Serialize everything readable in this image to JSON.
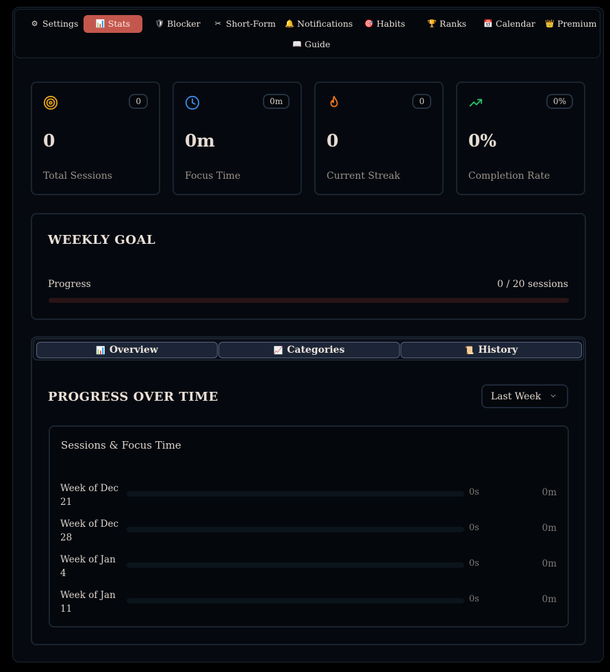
{
  "nav": {
    "items": [
      {
        "label": "Settings",
        "icon": "⚙"
      },
      {
        "label": "Stats",
        "icon": "📊"
      },
      {
        "label": "Blocker",
        "icon": "🛡"
      },
      {
        "label": "Short-Form",
        "icon": "✂"
      },
      {
        "label": "Notifications",
        "icon": "🔔"
      },
      {
        "label": "Habits",
        "icon": "🎯"
      },
      {
        "label": "Ranks",
        "icon": "🏆"
      },
      {
        "label": "Calendar",
        "icon": "📅"
      },
      {
        "label": "Premium",
        "icon": "👑"
      },
      {
        "label": "Guide",
        "icon": "📖"
      }
    ],
    "active": "Stats"
  },
  "stats": [
    {
      "badge": "0",
      "value": "0",
      "label": "Total Sessions",
      "icon": "target-icon",
      "color": "#e7a21c"
    },
    {
      "badge": "0m",
      "value": "0m",
      "label": "Focus Time",
      "icon": "clock-icon",
      "color": "#3b8be6"
    },
    {
      "badge": "0",
      "value": "0",
      "label": "Current Streak",
      "icon": "flame-icon",
      "color": "#f0731a"
    },
    {
      "badge": "0%",
      "value": "0%",
      "label": "Completion Rate",
      "icon": "trending-up-icon",
      "color": "#27c26b"
    }
  ],
  "weekly_goal": {
    "title": "WEEKLY GOAL",
    "progress_label": "Progress",
    "progress_value": "0 / 20 sessions",
    "completed": 0,
    "target": 20
  },
  "tabs": [
    {
      "label": "Overview",
      "icon": "📊"
    },
    {
      "label": "Categories",
      "icon": "📈"
    },
    {
      "label": "History",
      "icon": "📜"
    }
  ],
  "progress": {
    "title": "PROGRESS OVER TIME",
    "range": "Last Week",
    "chart_title": "Sessions & Focus Time"
  },
  "chart_data": {
    "type": "bar",
    "title": "Sessions & Focus Time",
    "categories": [
      "Week of Dec 21",
      "Week of Dec 28",
      "Week of Jan 4",
      "Week of Jan 11"
    ],
    "series": [
      {
        "name": "Sessions",
        "values": [
          0,
          0,
          0,
          0
        ],
        "labels": [
          "0s",
          "0s",
          "0s",
          "0s"
        ]
      },
      {
        "name": "Focus Time",
        "values": [
          0,
          0,
          0,
          0
        ],
        "labels": [
          "0m",
          "0m",
          "0m",
          "0m"
        ]
      }
    ]
  }
}
